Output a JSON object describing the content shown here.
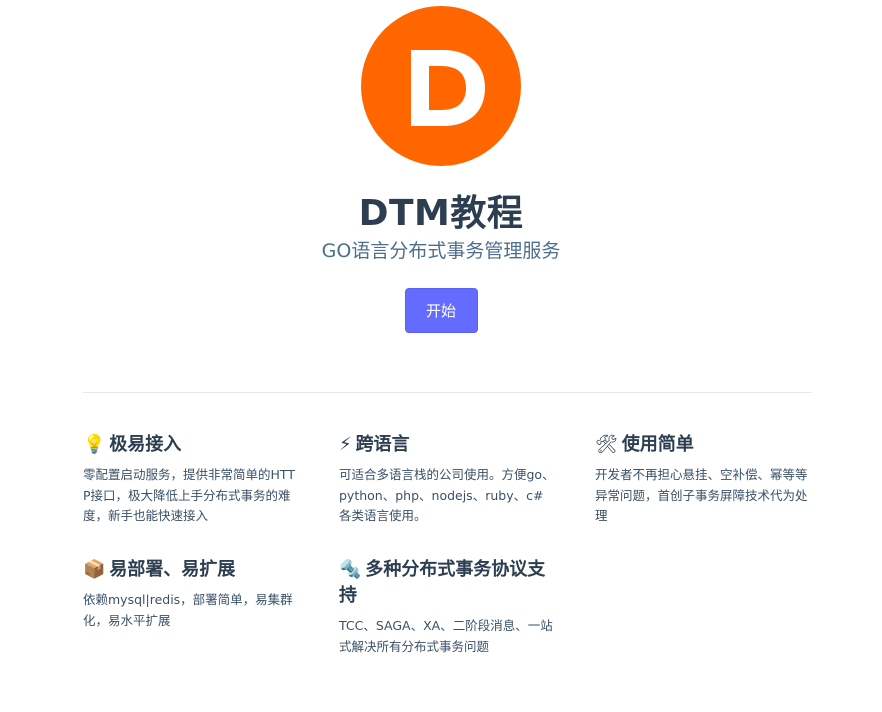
{
  "hero": {
    "logo_letter": "D",
    "title": "DTM教程",
    "description": "GO语言分布式事务管理服务",
    "action_label": "开始"
  },
  "colors": {
    "logo_bg": "#ff6600",
    "button_bg": "#646cff",
    "title": "#2c3e50",
    "description": "#4e6e8e"
  },
  "features": [
    {
      "icon": "lightbulb-icon",
      "emoji": "💡",
      "title": "极易接入",
      "details": "零配置启动服务，提供非常简单的HTTP接口，极大降低上手分布式事务的难度，新手也能快速接入"
    },
    {
      "icon": "lightning-icon",
      "emoji": "⚡",
      "title": "跨语言",
      "details": "可适合多语言栈的公司使用。方便go、python、php、nodejs、ruby、c# 各类语言使用。"
    },
    {
      "icon": "tools-icon",
      "emoji": "🛠",
      "title": "使用简单",
      "details": "开发者不再担心悬挂、空补偿、幂等等异常问题，首创子事务屏障技术代为处理"
    },
    {
      "icon": "package-icon",
      "emoji": "📦",
      "title": "易部署、易扩展",
      "details": "依赖mysql|redis，部署简单，易集群化，易水平扩展"
    },
    {
      "icon": "bolt-icon",
      "emoji": "🔩",
      "title": "多种分布式事务协议支持",
      "details": "TCC、SAGA、XA、二阶段消息、一站式解决所有分布式事务问题"
    }
  ]
}
